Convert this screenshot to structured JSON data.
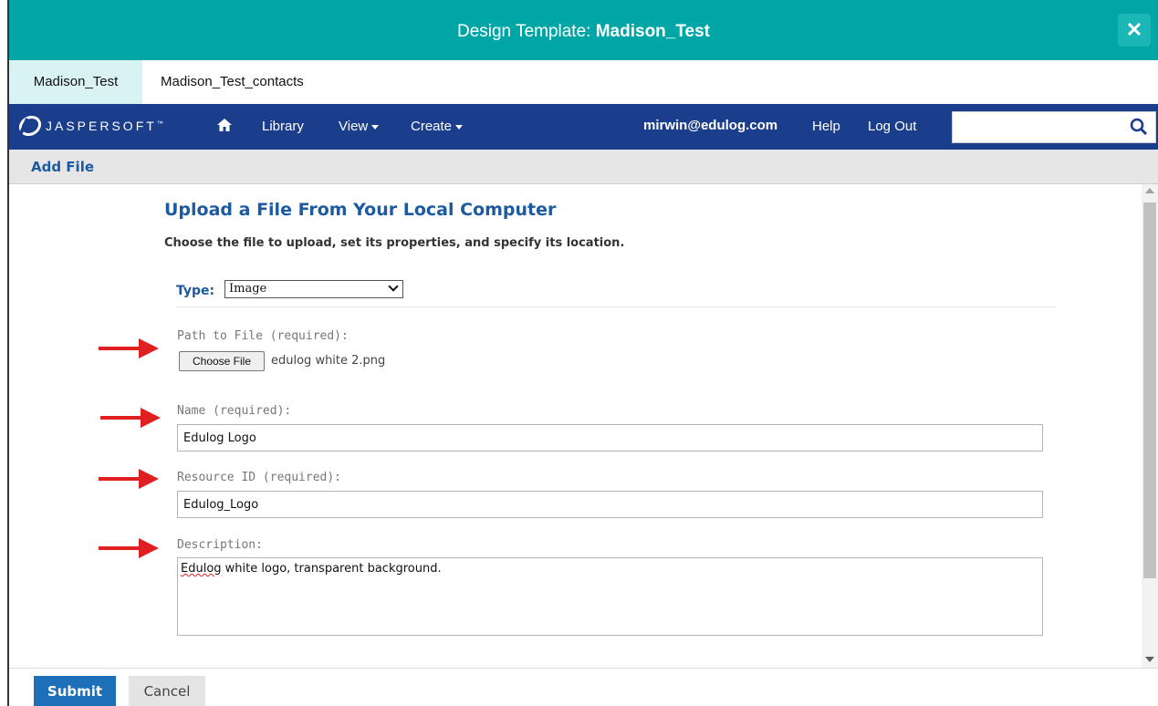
{
  "window": {
    "title_prefix": "Design Template: ",
    "title_name": "Madison_Test",
    "close_glyph": "✕"
  },
  "tabs": [
    {
      "label": "Madison_Test",
      "active": true
    },
    {
      "label": "Madison_Test_contacts",
      "active": false
    }
  ],
  "nav": {
    "logo_text": "JASPERSOFT",
    "logo_tm": "™",
    "home_icon": "home-icon",
    "library": "Library",
    "view": "View",
    "create": "Create",
    "user": "mirwin@edulog.com",
    "help": "Help",
    "logout": "Log Out",
    "search_value": "",
    "search_icon": "search-icon"
  },
  "subbar": {
    "label": "Add File"
  },
  "form": {
    "heading": "Upload a File From Your Local Computer",
    "subheading": "Choose the file to upload, set its properties, and specify its location.",
    "type_label": "Type:",
    "type_value": "Image",
    "path_label": "Path to File (required):",
    "choose_file_label": "Choose File",
    "file_name": "edulog white 2.png",
    "name_label": "Name (required):",
    "name_value": "Edulog Logo",
    "resource_id_label": "Resource ID (required):",
    "resource_id_value": "Edulog_Logo",
    "description_label": "Description:",
    "description_first_word": "Edulog",
    "description_rest": " white logo, transparent background."
  },
  "footer": {
    "submit": "Submit",
    "cancel": "Cancel"
  },
  "colors": {
    "titlebar": "#00a6a6",
    "navbar": "#1a3d8c",
    "heading": "#1d5aa0",
    "submit": "#1d6fb8",
    "arrow": "#e02020"
  }
}
